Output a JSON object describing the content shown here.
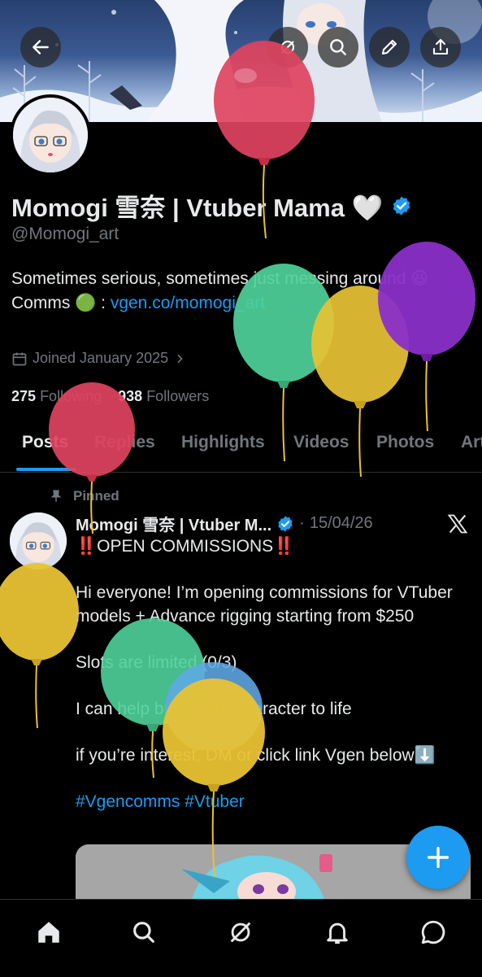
{
  "profile": {
    "display_name": "Momogi 雪奈 | Vtuber Mama 🤍",
    "handle": "@Momogi_art",
    "bio_line1": "Sometimes serious, sometimes just messing around 😆",
    "bio_comms_prefix": "Comms 🟢 : ",
    "bio_comms_link": "vgen.co/momogi_art",
    "joined": "Joined January 2025",
    "following_count": "275",
    "following_label": "Following",
    "followers_count": "938",
    "followers_label": "Followers"
  },
  "tabs": [
    "Posts",
    "Replies",
    "Highlights",
    "Videos",
    "Photos",
    "Art"
  ],
  "active_tab": "Posts",
  "pinned_post": {
    "pinned_label": "Pinned",
    "author_name": "Momogi 雪奈 | Vtuber M...",
    "date": "15/04/26",
    "separator": "·",
    "lines": [
      "‼️OPEN COMMISSIONS‼️",
      "",
      "Hi everyone! I’m opening commissions for VTuber models + Advance rigging starting from $250",
      "",
      "Slots are limited (0/3)",
      "",
      "I can help bring your character to life",
      "",
      "if you’re interest, DM or click link Vgen below⬇️",
      ""
    ],
    "hashtags": "#Vgencomms #Vtuber"
  },
  "icons": {
    "back": "arrow-left-icon",
    "search": "search-icon",
    "edit": "pencil-icon",
    "share": "share-icon",
    "verified": "verified-badge-icon",
    "calendar": "calendar-icon",
    "pin": "pin-icon",
    "x_logo": "x-logo-icon",
    "compose": "plus-icon",
    "nav": [
      "home-icon",
      "search-icon",
      "grok-icon",
      "notifications-icon",
      "messages-icon"
    ]
  },
  "colors": {
    "accent": "#1d9bf0",
    "background": "#000000",
    "text_primary": "#e7e9ea",
    "text_secondary": "#71767b"
  },
  "balloon_colors": [
    "#e0435f",
    "#4fd19a",
    "#e8c234",
    "#8a2fc8",
    "#e0435f",
    "#e8c234",
    "#4fd19a",
    "#5fa8e6",
    "#e8c234"
  ]
}
